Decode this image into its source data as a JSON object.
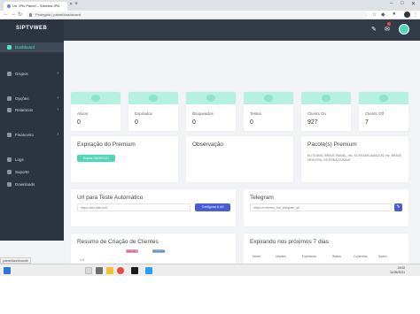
{
  "browser": {
    "tab_title": "Url. IPtv Painel – Sistema IPtv",
    "address": "Protegido | painel/dashboard",
    "status_url": "painel/dashboard#"
  },
  "app": {
    "logo_text": "SIPTVWEB"
  },
  "sidebar": {
    "items": [
      {
        "label": "Dashboard",
        "icon": "dashboard-icon",
        "active": true,
        "caret": ""
      },
      {
        "label": "Grupos",
        "icon": "users-icon",
        "active": false,
        "caret": "›"
      },
      {
        "label": "Opções",
        "icon": "list-icon",
        "active": false,
        "caret": "›"
      },
      {
        "label": "Relatórios",
        "icon": "chart-icon",
        "active": false,
        "caret": "›"
      },
      {
        "label": "Financeiro",
        "icon": "money-icon",
        "active": false,
        "caret": "›"
      },
      {
        "label": "Logs",
        "icon": "file-icon",
        "active": false,
        "caret": ""
      },
      {
        "label": "Suporte",
        "icon": "support-icon",
        "active": false,
        "caret": ""
      },
      {
        "label": "Downloads",
        "icon": "download-icon",
        "active": false,
        "caret": ""
      }
    ]
  },
  "stats": [
    {
      "label": "Ativos",
      "value": "0"
    },
    {
      "label": "Expirados",
      "value": "0"
    },
    {
      "label": "Bloqueados",
      "value": "0"
    },
    {
      "label": "Testes",
      "value": "0"
    },
    {
      "label": "Clients On",
      "value": "927"
    },
    {
      "label": "Clients Off",
      "value": "7"
    }
  ],
  "premium": {
    "title": "Expiração do Premium",
    "button": "Expira: 03/05/2021"
  },
  "observacao": {
    "title": "Observação"
  },
  "pacote": {
    "title": "Pacote(s) Premium",
    "text": "ELITEAMS, BRAVE PAINEL, etc. ELITEAMS-AMAZON, etc. BRAVE NEW ERA, INTERNACIONAIS"
  },
  "url_teste": {
    "title": "Url para Teste Automático",
    "placeholder": "https://seu.site.com",
    "button": "Configurar A Url"
  },
  "telegram": {
    "title": "Telegram",
    "placeholder": "https://t.me/seu_bot_telegram_url",
    "button_icon": "edit-icon"
  },
  "resumo": {
    "title": "Resumo de Criação de Clientes",
    "legend": [
      "Clientes",
      "Revendas"
    ],
    "colors": [
      "#f29bb6",
      "#8fb8d9"
    ],
    "axis_tick": "1.0"
  },
  "expirando": {
    "title": "Expirando nos próximos 7 dias",
    "columns": [
      "Nome",
      "Usuário",
      "Expirando",
      "Status",
      "Conexões",
      "Ações"
    ]
  },
  "tray": {
    "time": "15:02",
    "date": "11/05/2021"
  },
  "accent": "#4fd6b8",
  "sidebar_bg": "#2c3440"
}
